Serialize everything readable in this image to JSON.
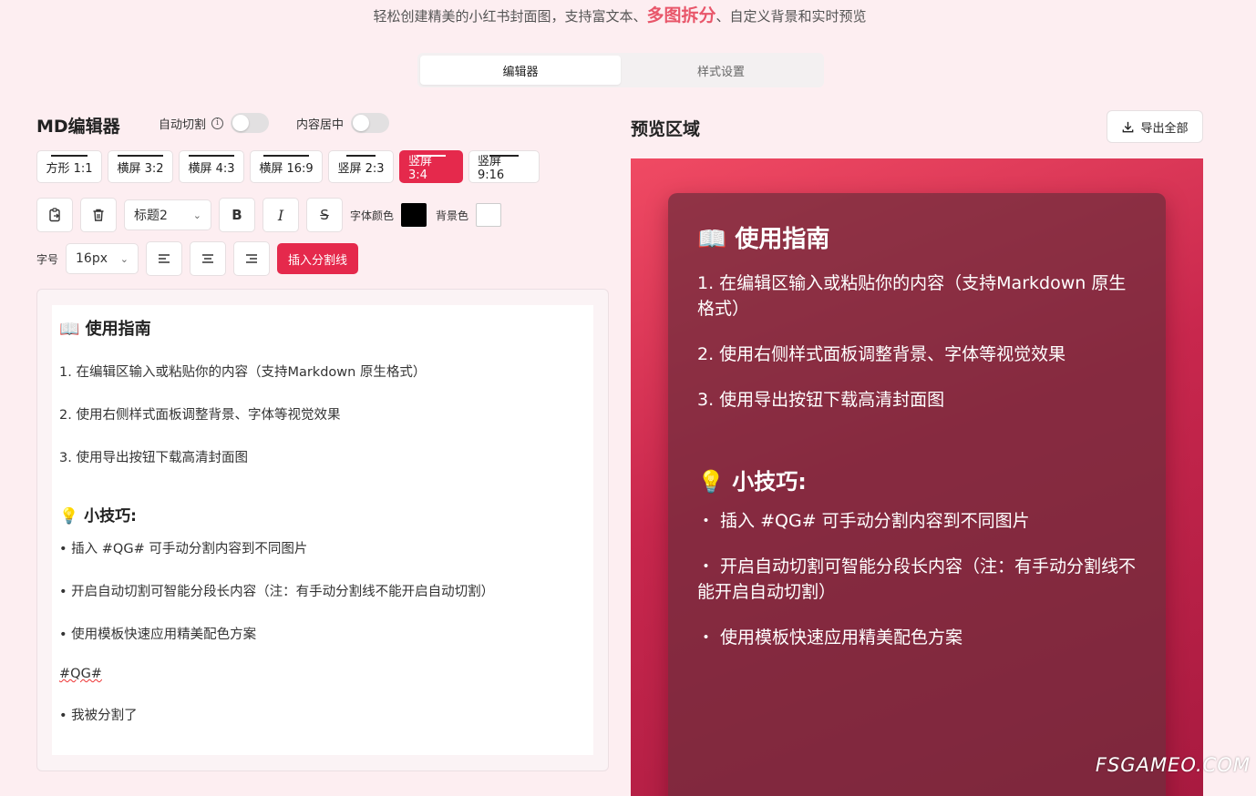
{
  "header": {
    "subtitle_pre": "轻松创建精美的小红书封面图，支持富文本、",
    "subtitle_hl": "多图拆分",
    "subtitle_post": "、自定义背景和实时预览"
  },
  "tabs": [
    {
      "label": "编辑器",
      "active": true
    },
    {
      "label": "样式设置",
      "active": false
    }
  ],
  "editor_panel": {
    "title": "MD编辑器",
    "auto_split_label": "自动切割",
    "center_label": "内容居中",
    "ratios": [
      {
        "label": "方形 1:1",
        "active": false
      },
      {
        "label": "横屏 3:2",
        "active": false
      },
      {
        "label": "横屏 4:3",
        "active": false
      },
      {
        "label": "横屏 16:9",
        "active": false
      },
      {
        "label": "竖屏 2:3",
        "active": false
      },
      {
        "label": "竖屏 3:4",
        "active": true
      },
      {
        "label": "竖屏 9:16",
        "active": false
      }
    ],
    "heading_select": "标题2",
    "bold": "B",
    "italic": "I",
    "strike": "S",
    "font_color_label": "字体颜色",
    "font_color": "#000000",
    "bg_color_label": "背景色",
    "bg_color": "#ffffff",
    "font_size_label": "字号",
    "font_size": "16px",
    "insert_divider": "插入分割线"
  },
  "editor_content": {
    "heading": "📖 使用指南",
    "steps": [
      "1. 在编辑区输入或粘贴你的内容（支持Markdown 原生格式）",
      "2. 使用右侧样式面板调整背景、字体等视觉效果",
      "3. 使用导出按钮下载高清封面图"
    ],
    "tips_heading": "💡 小技巧:",
    "tips": [
      "• 插入 #QG# 可手动分割内容到不同图片",
      "• 开启自动切割可智能分段长内容（注：有手动分割线不能开启自动切割）",
      "• 使用模板快速应用精美配色方案"
    ],
    "divider_marker": "#QG#",
    "after_divider": "• 我被分割了"
  },
  "preview_panel": {
    "title": "预览区域",
    "export_label": "导出全部",
    "heading": "📖 使用指南",
    "steps": [
      "1. 在编辑区输入或粘贴你的内容（支持Markdown 原生格式）",
      "2. 使用右侧样式面板调整背景、字体等视觉效果",
      "3. 使用导出按钮下载高清封面图"
    ],
    "tips_heading": "💡 小技巧:",
    "tips": [
      "・ 插入 #QG# 可手动分割内容到不同图片",
      "・ 开启自动切割可智能分段长内容（注：有手动分割线不能开启自动切割）",
      "・ 使用模板快速应用精美配色方案"
    ]
  },
  "watermark": "FSGAMEO.COM",
  "colors": {
    "accent": "#e5294c",
    "page_bg": "#fdeef1"
  }
}
